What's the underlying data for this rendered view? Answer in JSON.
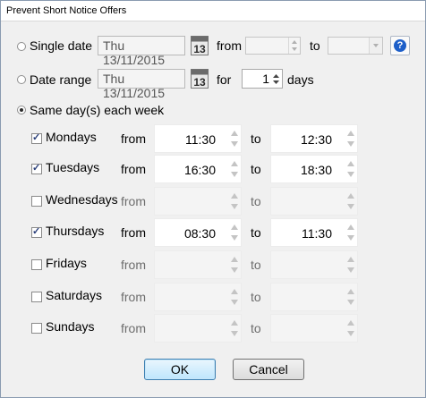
{
  "window": {
    "title": "Prevent Short Notice Offers"
  },
  "single_date": {
    "label": "Single date",
    "date_value": "Thu 13/11/2015",
    "calendar_day": "13",
    "from_label": "from",
    "to_label": "to",
    "from_value": "",
    "to_value": "",
    "selected": false
  },
  "date_range": {
    "label": "Date range",
    "date_value": "Thu 13/11/2015",
    "calendar_day": "13",
    "for_label": "for",
    "days_value": "1",
    "days_label": "days",
    "selected": false
  },
  "weekly": {
    "label": "Same day(s) each week",
    "selected": true
  },
  "days": [
    {
      "name": "Mondays",
      "checked": true,
      "from_label": "from",
      "to_label": "to",
      "from_value": "11:30",
      "to_value": "12:30"
    },
    {
      "name": "Tuesdays",
      "checked": true,
      "from_label": "from",
      "to_label": "to",
      "from_value": "16:30",
      "to_value": "18:30"
    },
    {
      "name": "Wednesdays",
      "checked": false,
      "from_label": "from",
      "to_label": "to",
      "from_value": "",
      "to_value": ""
    },
    {
      "name": "Thursdays",
      "checked": true,
      "from_label": "from",
      "to_label": "to",
      "from_value": "08:30",
      "to_value": "11:30"
    },
    {
      "name": "Fridays",
      "checked": false,
      "from_label": "from",
      "to_label": "to",
      "from_value": "",
      "to_value": ""
    },
    {
      "name": "Saturdays",
      "checked": false,
      "from_label": "from",
      "to_label": "to",
      "from_value": "",
      "to_value": ""
    },
    {
      "name": "Sundays",
      "checked": false,
      "from_label": "from",
      "to_label": "to",
      "from_value": "",
      "to_value": ""
    }
  ],
  "buttons": {
    "ok": "OK",
    "cancel": "Cancel"
  },
  "colors": {
    "help_icon": "#1d5fc9",
    "ok_border": "#3c7fb1",
    "window_bg": "#f0f0f0"
  }
}
